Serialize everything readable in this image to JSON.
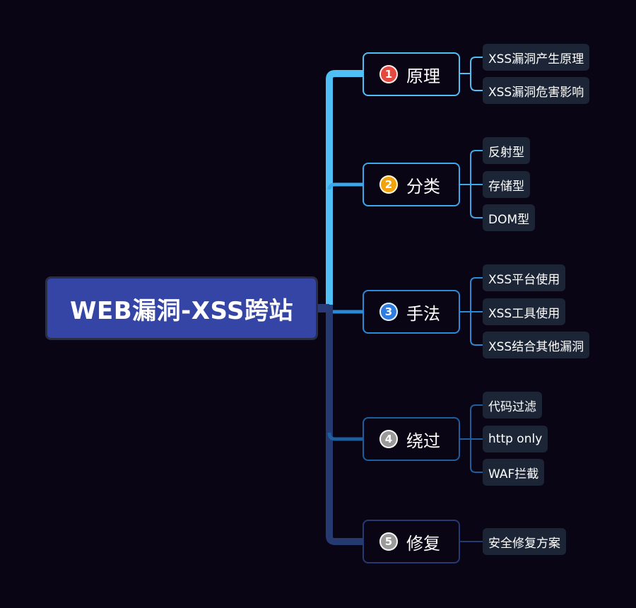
{
  "root": {
    "title": "WEB漏洞-XSS跨站"
  },
  "colors": {
    "background": "#0a0514",
    "root_fill": "#3545a6",
    "leaf_fill": "#1c2536",
    "branch_1": "#4fc0f5",
    "branch_2": "#3aa8ea",
    "branch_3": "#2b8ad8",
    "branch_4": "#1d5e9e",
    "branch_5": "#263a72"
  },
  "branches": [
    {
      "number": "1",
      "label": "原理",
      "badge_color": "#e5483f",
      "children": [
        "XSS漏洞产生原理",
        "XSS漏洞危害影响"
      ]
    },
    {
      "number": "2",
      "label": "分类",
      "badge_color": "#f2a20c",
      "children": [
        "反射型",
        "存储型",
        "DOM型"
      ]
    },
    {
      "number": "3",
      "label": "手法",
      "badge_color": "#2f7de0",
      "children": [
        "XSS平台使用",
        "XSS工具使用",
        "XSS结合其他漏洞"
      ]
    },
    {
      "number": "4",
      "label": "绕过",
      "badge_color": "#9a9a9a",
      "children": [
        "代码过滤",
        "http only",
        "WAF拦截"
      ]
    },
    {
      "number": "5",
      "label": "修复",
      "badge_color": "#9a9a9a",
      "children": [
        "安全修复方案"
      ]
    }
  ]
}
